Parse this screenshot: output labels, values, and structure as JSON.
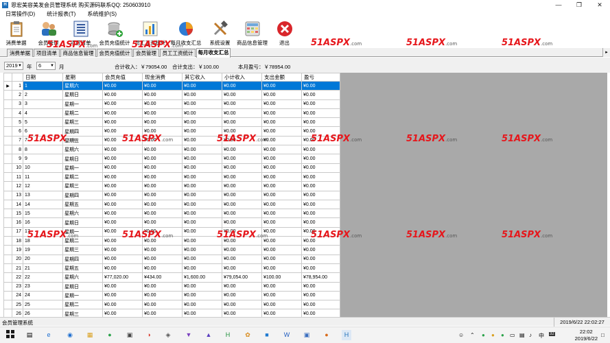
{
  "window": {
    "title": "恩宏美容美发会员管理系统  购买源码联系QQ:  250603910",
    "controls": [
      "minimize-icon",
      "maximize-icon",
      "close-icon"
    ]
  },
  "menu": [
    "日常操作(D)",
    "统计报表(T)",
    "系统维护(S)"
  ],
  "toolbar": [
    {
      "label": "消费单据",
      "icon": "clipboard-icon"
    },
    {
      "label": "会员管理",
      "icon": "users-icon"
    },
    {
      "label": "项目清单",
      "icon": "list-icon"
    },
    {
      "label": "会员充值统计",
      "icon": "coins-icon"
    },
    {
      "label": "员工工资统计",
      "icon": "bar-chart-icon"
    },
    {
      "label": "每月收支汇总",
      "icon": "pie-chart-icon"
    },
    {
      "label": "系统设置",
      "icon": "tools-icon"
    },
    {
      "label": "商品信息管理",
      "icon": "calculator-icon"
    },
    {
      "label": "退出",
      "icon": "exit-icon"
    }
  ],
  "tabs": [
    {
      "label": "消费单据"
    },
    {
      "label": "项目清单"
    },
    {
      "label": "商品信息管理"
    },
    {
      "label": "会员充值统计"
    },
    {
      "label": "会员管理"
    },
    {
      "label": "员工工资统计"
    },
    {
      "label": "每月收支汇总",
      "active": true
    }
  ],
  "filter": {
    "year": "2019",
    "year_label": "年",
    "month": "6",
    "month_label": "月",
    "total_income": "合计收入：￥79054.00",
    "total_expense": "合计支出：￥100.00",
    "month_profit": "本月盈亏：￥78954.00"
  },
  "table": {
    "columns": [
      "日期",
      "星期",
      "会员充值",
      "现金消费",
      "其它收入",
      "小计收入",
      "支出金额",
      "盈亏"
    ],
    "rows": [
      [
        "1",
        "星期六",
        "¥0.00",
        "¥0.00",
        "¥0.00",
        "¥0.00",
        "¥0.00",
        "¥0.00"
      ],
      [
        "2",
        "星期日",
        "¥0.00",
        "¥0.00",
        "¥0.00",
        "¥0.00",
        "¥0.00",
        "¥0.00"
      ],
      [
        "3",
        "星期一",
        "¥0.00",
        "¥0.00",
        "¥0.00",
        "¥0.00",
        "¥0.00",
        "¥0.00"
      ],
      [
        "4",
        "星期二",
        "¥0.00",
        "¥0.00",
        "¥0.00",
        "¥0.00",
        "¥0.00",
        "¥0.00"
      ],
      [
        "5",
        "星期三",
        "¥0.00",
        "¥0.00",
        "¥0.00",
        "¥0.00",
        "¥0.00",
        "¥0.00"
      ],
      [
        "6",
        "星期四",
        "¥0.00",
        "¥0.00",
        "¥0.00",
        "¥0.00",
        "¥0.00",
        "¥0.00"
      ],
      [
        "7",
        "星期五",
        "¥0.00",
        "¥0.00",
        "¥0.00",
        "¥0.00",
        "¥0.00",
        "¥0.00"
      ],
      [
        "8",
        "星期六",
        "¥0.00",
        "¥0.00",
        "¥0.00",
        "¥0.00",
        "¥0.00",
        "¥0.00"
      ],
      [
        "9",
        "星期日",
        "¥0.00",
        "¥0.00",
        "¥0.00",
        "¥0.00",
        "¥0.00",
        "¥0.00"
      ],
      [
        "10",
        "星期一",
        "¥0.00",
        "¥0.00",
        "¥0.00",
        "¥0.00",
        "¥0.00",
        "¥0.00"
      ],
      [
        "11",
        "星期二",
        "¥0.00",
        "¥0.00",
        "¥0.00",
        "¥0.00",
        "¥0.00",
        "¥0.00"
      ],
      [
        "12",
        "星期三",
        "¥0.00",
        "¥0.00",
        "¥0.00",
        "¥0.00",
        "¥0.00",
        "¥0.00"
      ],
      [
        "13",
        "星期四",
        "¥0.00",
        "¥0.00",
        "¥0.00",
        "¥0.00",
        "¥0.00",
        "¥0.00"
      ],
      [
        "14",
        "星期五",
        "¥0.00",
        "¥0.00",
        "¥0.00",
        "¥0.00",
        "¥0.00",
        "¥0.00"
      ],
      [
        "15",
        "星期六",
        "¥0.00",
        "¥0.00",
        "¥0.00",
        "¥0.00",
        "¥0.00",
        "¥0.00"
      ],
      [
        "16",
        "星期日",
        "¥0.00",
        "¥0.00",
        "¥0.00",
        "¥0.00",
        "¥0.00",
        "¥0.00"
      ],
      [
        "17",
        "星期一",
        "¥0.00",
        "¥0.00",
        "¥0.00",
        "¥0.00",
        "¥0.00",
        "¥0.00"
      ],
      [
        "18",
        "星期二",
        "¥0.00",
        "¥0.00",
        "¥0.00",
        "¥0.00",
        "¥0.00",
        "¥0.00"
      ],
      [
        "19",
        "星期三",
        "¥0.00",
        "¥0.00",
        "¥0.00",
        "¥0.00",
        "¥0.00",
        "¥0.00"
      ],
      [
        "20",
        "星期四",
        "¥0.00",
        "¥0.00",
        "¥0.00",
        "¥0.00",
        "¥0.00",
        "¥0.00"
      ],
      [
        "21",
        "星期五",
        "¥0.00",
        "¥0.00",
        "¥0.00",
        "¥0.00",
        "¥0.00",
        "¥0.00"
      ],
      [
        "22",
        "星期六",
        "¥77,020.00",
        "¥434.00",
        "¥1,600.00",
        "¥79,054.00",
        "¥100.00",
        "¥78,954.00"
      ],
      [
        "23",
        "星期日",
        "¥0.00",
        "¥0.00",
        "¥0.00",
        "¥0.00",
        "¥0.00",
        "¥0.00"
      ],
      [
        "24",
        "星期一",
        "¥0.00",
        "¥0.00",
        "¥0.00",
        "¥0.00",
        "¥0.00",
        "¥0.00"
      ],
      [
        "25",
        "星期二",
        "¥0.00",
        "¥0.00",
        "¥0.00",
        "¥0.00",
        "¥0.00",
        "¥0.00"
      ],
      [
        "26",
        "星期三",
        "¥0.00",
        "¥0.00",
        "¥0.00",
        "¥0.00",
        "¥0.00",
        "¥0.00"
      ]
    ],
    "selected_row": 1
  },
  "status": {
    "left": "会员管理系统",
    "right": "2019/6/22 22:02:27"
  },
  "taskbar": {
    "time": "22:02",
    "date": "2019/6/22",
    "ime": "中",
    "badge": "32"
  },
  "watermark": {
    "brand": "51",
    "mid": "ASPX",
    "suffix": ".com"
  }
}
